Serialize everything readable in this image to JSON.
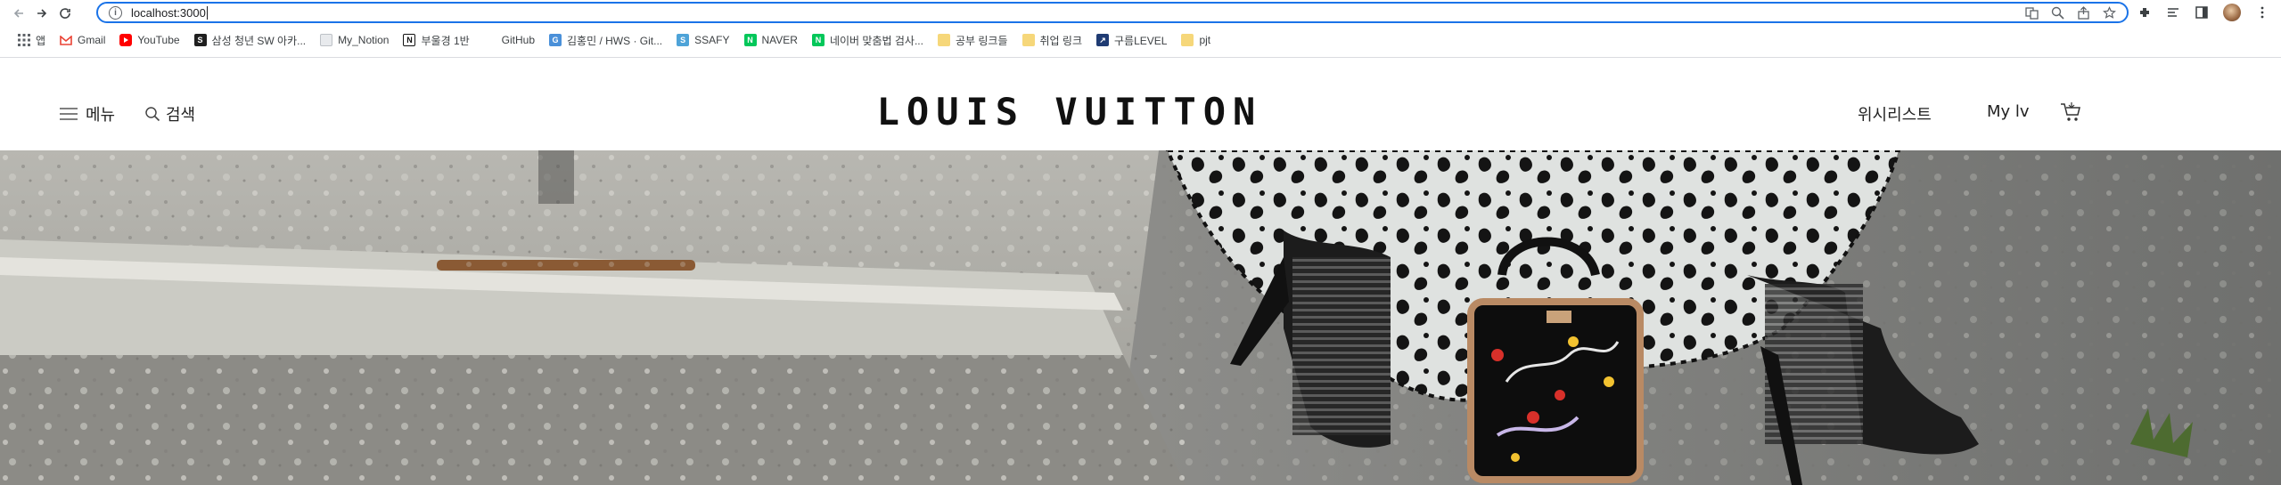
{
  "browser": {
    "url": "localhost:3000",
    "bookmarks": [
      {
        "label": "앱",
        "icon": "apps-grid-icon",
        "color": "#4285f4"
      },
      {
        "label": "Gmail",
        "icon": "gmail-icon",
        "color": "#ea4335"
      },
      {
        "label": "YouTube",
        "icon": "youtube-icon",
        "color": "#ff0000"
      },
      {
        "label": "삼성 청년 SW 아카...",
        "icon": "ssafy-bookmark-icon",
        "color": "#1f1f1f"
      },
      {
        "label": "My_Notion",
        "icon": "notion-page-icon",
        "color": "#9aa0a6"
      },
      {
        "label": "부울경 1반",
        "icon": "notion-icon",
        "color": "#111111"
      },
      {
        "label": "GitHub",
        "icon": "github-icon",
        "color": "#ffffff"
      },
      {
        "label": "김홍민 / HWS · Git...",
        "icon": "git-icon",
        "color": "#4a90d9"
      },
      {
        "label": "SSAFY",
        "icon": "ssafy-icon",
        "color": "#4ea3d8"
      },
      {
        "label": "NAVER",
        "icon": "naver-icon",
        "color": "#03c75a"
      },
      {
        "label": "네이버 맞춤법 검사...",
        "icon": "naver-icon",
        "color": "#03c75a"
      },
      {
        "label": "공부 링크들",
        "icon": "folder-icon",
        "color": "#f6d77a"
      },
      {
        "label": "취업 링크",
        "icon": "folder-icon",
        "color": "#f6d77a"
      },
      {
        "label": "구름LEVEL",
        "icon": "goorm-icon",
        "color": "#1f3b73"
      },
      {
        "label": "pjt",
        "icon": "folder-icon",
        "color": "#f6d77a"
      }
    ]
  },
  "header": {
    "menu_label": "메뉴",
    "search_label": "검색",
    "logo": "LOUIS VUITTON",
    "wishlist_label": "위시리스트",
    "mylv_label": "My lv"
  },
  "hero": {
    "description_icon": "fashion-hero-image"
  },
  "colors": {
    "accent": "#1a73e8",
    "brand_text": "#111111"
  }
}
